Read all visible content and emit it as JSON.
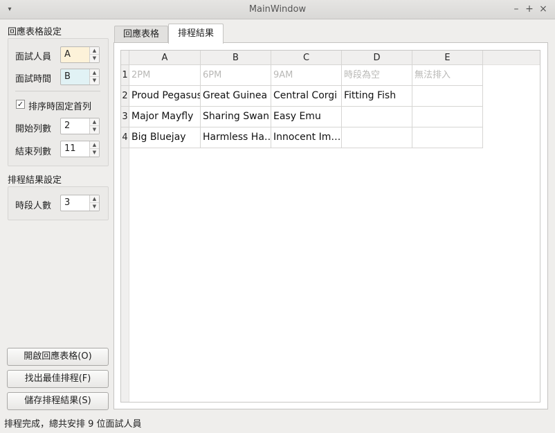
{
  "window": {
    "title": "MainWindow",
    "menu_glyph": "▾",
    "minimize_glyph": "–",
    "maximize_glyph": "+",
    "close_glyph": "×"
  },
  "response_settings": {
    "title": "回應表格設定",
    "interviewer_label": "面試人員",
    "interviewer_value": "A",
    "time_label": "面試時間",
    "time_value": "B",
    "fixed_first_row_label": "排序時固定首列",
    "fixed_first_row_checked": "✓",
    "start_col_label": "開始列數",
    "start_col_value": "2",
    "end_col_label": "結束列數",
    "end_col_value": "11"
  },
  "result_settings": {
    "title": "排程結果設定",
    "per_slot_label": "時段人數",
    "per_slot_value": "3"
  },
  "buttons": {
    "open": "開啟回應表格(O)",
    "find": "找出最佳排程(F)",
    "save": "儲存排程結果(S)"
  },
  "spin_glyphs": {
    "up": "▲",
    "down": "▼"
  },
  "tabs": [
    {
      "label": "回應表格"
    },
    {
      "label": "排程結果"
    }
  ],
  "table": {
    "columns": [
      "A",
      "B",
      "C",
      "D",
      "E"
    ],
    "row_numbers": [
      "1",
      "2",
      "3",
      "4"
    ],
    "header_row": [
      "2PM",
      "6PM",
      "9AM",
      "時段為空",
      "無法排入"
    ],
    "rows": [
      [
        "Proud Pegasus",
        "Great Guinea",
        "Central Corgi",
        "Fitting Fish",
        ""
      ],
      [
        "Major Mayfly",
        "Sharing Swan",
        "Easy Emu",
        "",
        ""
      ],
      [
        "Big Bluejay",
        "Harmless Ha…",
        "Innocent Im…",
        "",
        ""
      ]
    ]
  },
  "status": "排程完成，總共安排 9 位面試人員"
}
